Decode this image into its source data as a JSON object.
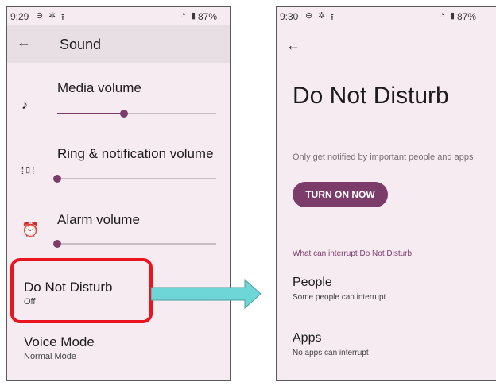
{
  "left_screen": {
    "status": {
      "time": "9:29",
      "battery": "87%"
    },
    "title": "Sound",
    "rows": [
      {
        "label": "Media volume",
        "level": 0.42
      },
      {
        "label": "Ring & notification volume",
        "level": 0.0
      },
      {
        "label": "Alarm volume",
        "level": 0.0
      }
    ],
    "dnd": {
      "title": "Do Not Disturb",
      "sub": "Off"
    },
    "voice": {
      "title": "Voice Mode",
      "sub": "Normal Mode"
    }
  },
  "right_screen": {
    "status": {
      "time": "9:30",
      "battery": "87%"
    },
    "title": "Do Not Disturb",
    "description": "Only get notified by important people and apps",
    "button": "TURN ON NOW",
    "section": "What can interrupt Do Not Disturb",
    "items": [
      {
        "title": "People",
        "sub": "Some people can interrupt"
      },
      {
        "title": "Apps",
        "sub": "No apps can interrupt"
      }
    ]
  },
  "colors": {
    "accent": "#7b3c6a",
    "highlight": "#e8141e",
    "arrow": "#6fd6d8"
  }
}
